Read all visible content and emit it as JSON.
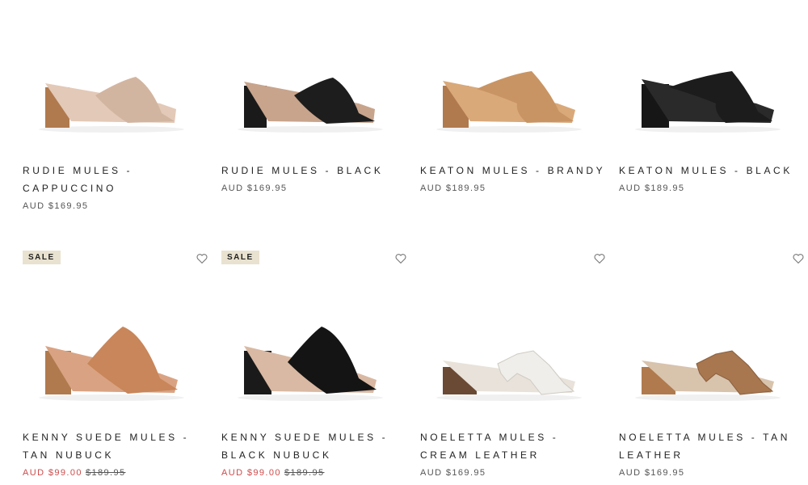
{
  "products": [
    {
      "title": "Rudie Mules - Cappuccino",
      "price": "AUD $169.95",
      "colors": {
        "upper": "#d2b5a0",
        "heel": "#b07a4e",
        "inner": "#e3c9b7"
      }
    },
    {
      "title": "Rudie Mules - Black",
      "price": "AUD $169.95",
      "colors": {
        "upper": "#1d1d1d",
        "heel": "#1a1a1a",
        "inner": "#c8a48c"
      }
    },
    {
      "title": "Keaton Mules - Brandy",
      "price": "AUD $189.95",
      "colors": {
        "upper": "#c99463",
        "heel": "#b07a4e",
        "inner": "#d9a97a"
      }
    },
    {
      "title": "Keaton Mules - Black",
      "price": "AUD $189.95",
      "colors": {
        "upper": "#1c1c1c",
        "heel": "#161616",
        "inner": "#2a2a2a"
      }
    },
    {
      "title": "Kenny Suede Mules - Tan Nubuck",
      "badge": "SALE",
      "sale_price": "AUD $99.00",
      "original_price": "$189.95",
      "colors": {
        "upper": "#c8865a",
        "heel": "#b07a4e",
        "inner": "#d9a383"
      }
    },
    {
      "title": "Kenny Suede Mules - Black Nubuck",
      "badge": "SALE",
      "sale_price": "AUD $99.00",
      "original_price": "$189.95",
      "colors": {
        "upper": "#141414",
        "heel": "#1a1a1a",
        "inner": "#d9b9a3"
      }
    },
    {
      "title": "Noeletta Mules - Cream Leather",
      "price": "AUD $169.95",
      "colors": {
        "upper": "#efeeea",
        "heel": "#6a4a35",
        "inner": "#e8e2da"
      }
    },
    {
      "title": "Noeletta Mules - Tan Leather",
      "price": "AUD $169.95",
      "colors": {
        "upper": "#a8774f",
        "heel": "#b07a4e",
        "inner": "#d8c3ad"
      }
    }
  ],
  "icons": {
    "wishlist": "heart-icon"
  }
}
